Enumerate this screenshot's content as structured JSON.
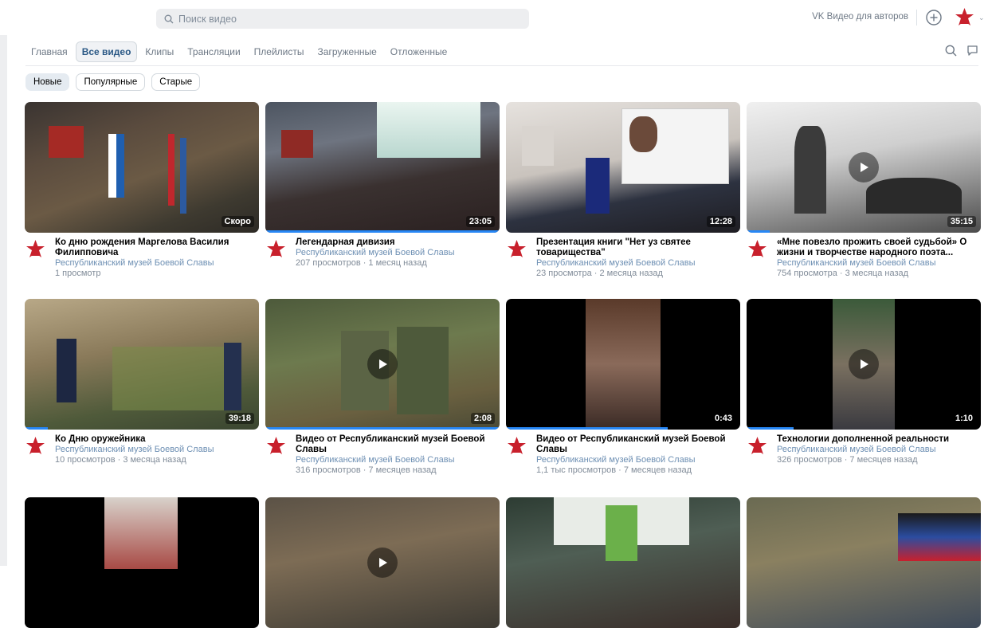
{
  "header": {
    "search_placeholder": "Поиск видео",
    "authors_link": "VK Видео для авторов"
  },
  "tabs": [
    {
      "label": "Главная",
      "active": false
    },
    {
      "label": "Все видео",
      "active": true
    },
    {
      "label": "Клипы",
      "active": false
    },
    {
      "label": "Трансляции",
      "active": false
    },
    {
      "label": "Плейлисты",
      "active": false
    },
    {
      "label": "Загруженные",
      "active": false
    },
    {
      "label": "Отложенные",
      "active": false
    }
  ],
  "filters": [
    {
      "label": "Новые",
      "active": true
    },
    {
      "label": "Популярные",
      "active": false
    },
    {
      "label": "Старые",
      "active": false
    }
  ],
  "channel": "Республиканский музей Боевой Славы",
  "colors": {
    "accent": "#2787f5",
    "link": "#2a5885",
    "brand_red": "#c8202c"
  },
  "videos": [
    {
      "title": "Ко дню рождения Маргелова Василия Филипповича",
      "duration": "Скоро",
      "stats": "1 просмотр",
      "progress": 0,
      "play": false
    },
    {
      "title": "Легендарная дивизия",
      "duration": "23:05",
      "stats": "207 просмотров · 1 месяц назад",
      "progress": 1.0,
      "play": false
    },
    {
      "title": "Презентация книги \"Нет уз святее товарищества\"",
      "duration": "12:28",
      "stats": "23 просмотра · 2 месяца назад",
      "progress": 0,
      "play": false
    },
    {
      "title": "«Мне повезло прожить своей судьбой» О жизни и творчестве народного поэта...",
      "duration": "35:15",
      "stats": "754 просмотра · 3 месяца назад",
      "progress": 0.1,
      "play": true
    },
    {
      "title": "Ко Дню оружейника",
      "duration": "39:18",
      "stats": "10 просмотров · 3 месяца назад",
      "progress": 0.1,
      "play": false
    },
    {
      "title": "Видео от Республиканский музей Боевой Славы",
      "duration": "2:08",
      "stats": "316 просмотров · 7 месяцев назад",
      "progress": 1.0,
      "play": true
    },
    {
      "title": "Видео от Республиканский музей Боевой Славы",
      "duration": "0:43",
      "stats": "1,1 тыс просмотров · 7 месяцев назад",
      "progress": 0.69,
      "play": false
    },
    {
      "title": "Технологии дополненной реальности",
      "duration": "1:10",
      "stats": "326 просмотров · 7 месяцев назад",
      "progress": 0.2,
      "play": true
    },
    {
      "title": "",
      "duration": "",
      "stats": "",
      "progress": 0,
      "play": false
    },
    {
      "title": "",
      "duration": "",
      "stats": "",
      "progress": 0,
      "play": true
    },
    {
      "title": "",
      "duration": "",
      "stats": "",
      "progress": 0,
      "play": false
    },
    {
      "title": "",
      "duration": "",
      "stats": "",
      "progress": 0,
      "play": false
    }
  ]
}
